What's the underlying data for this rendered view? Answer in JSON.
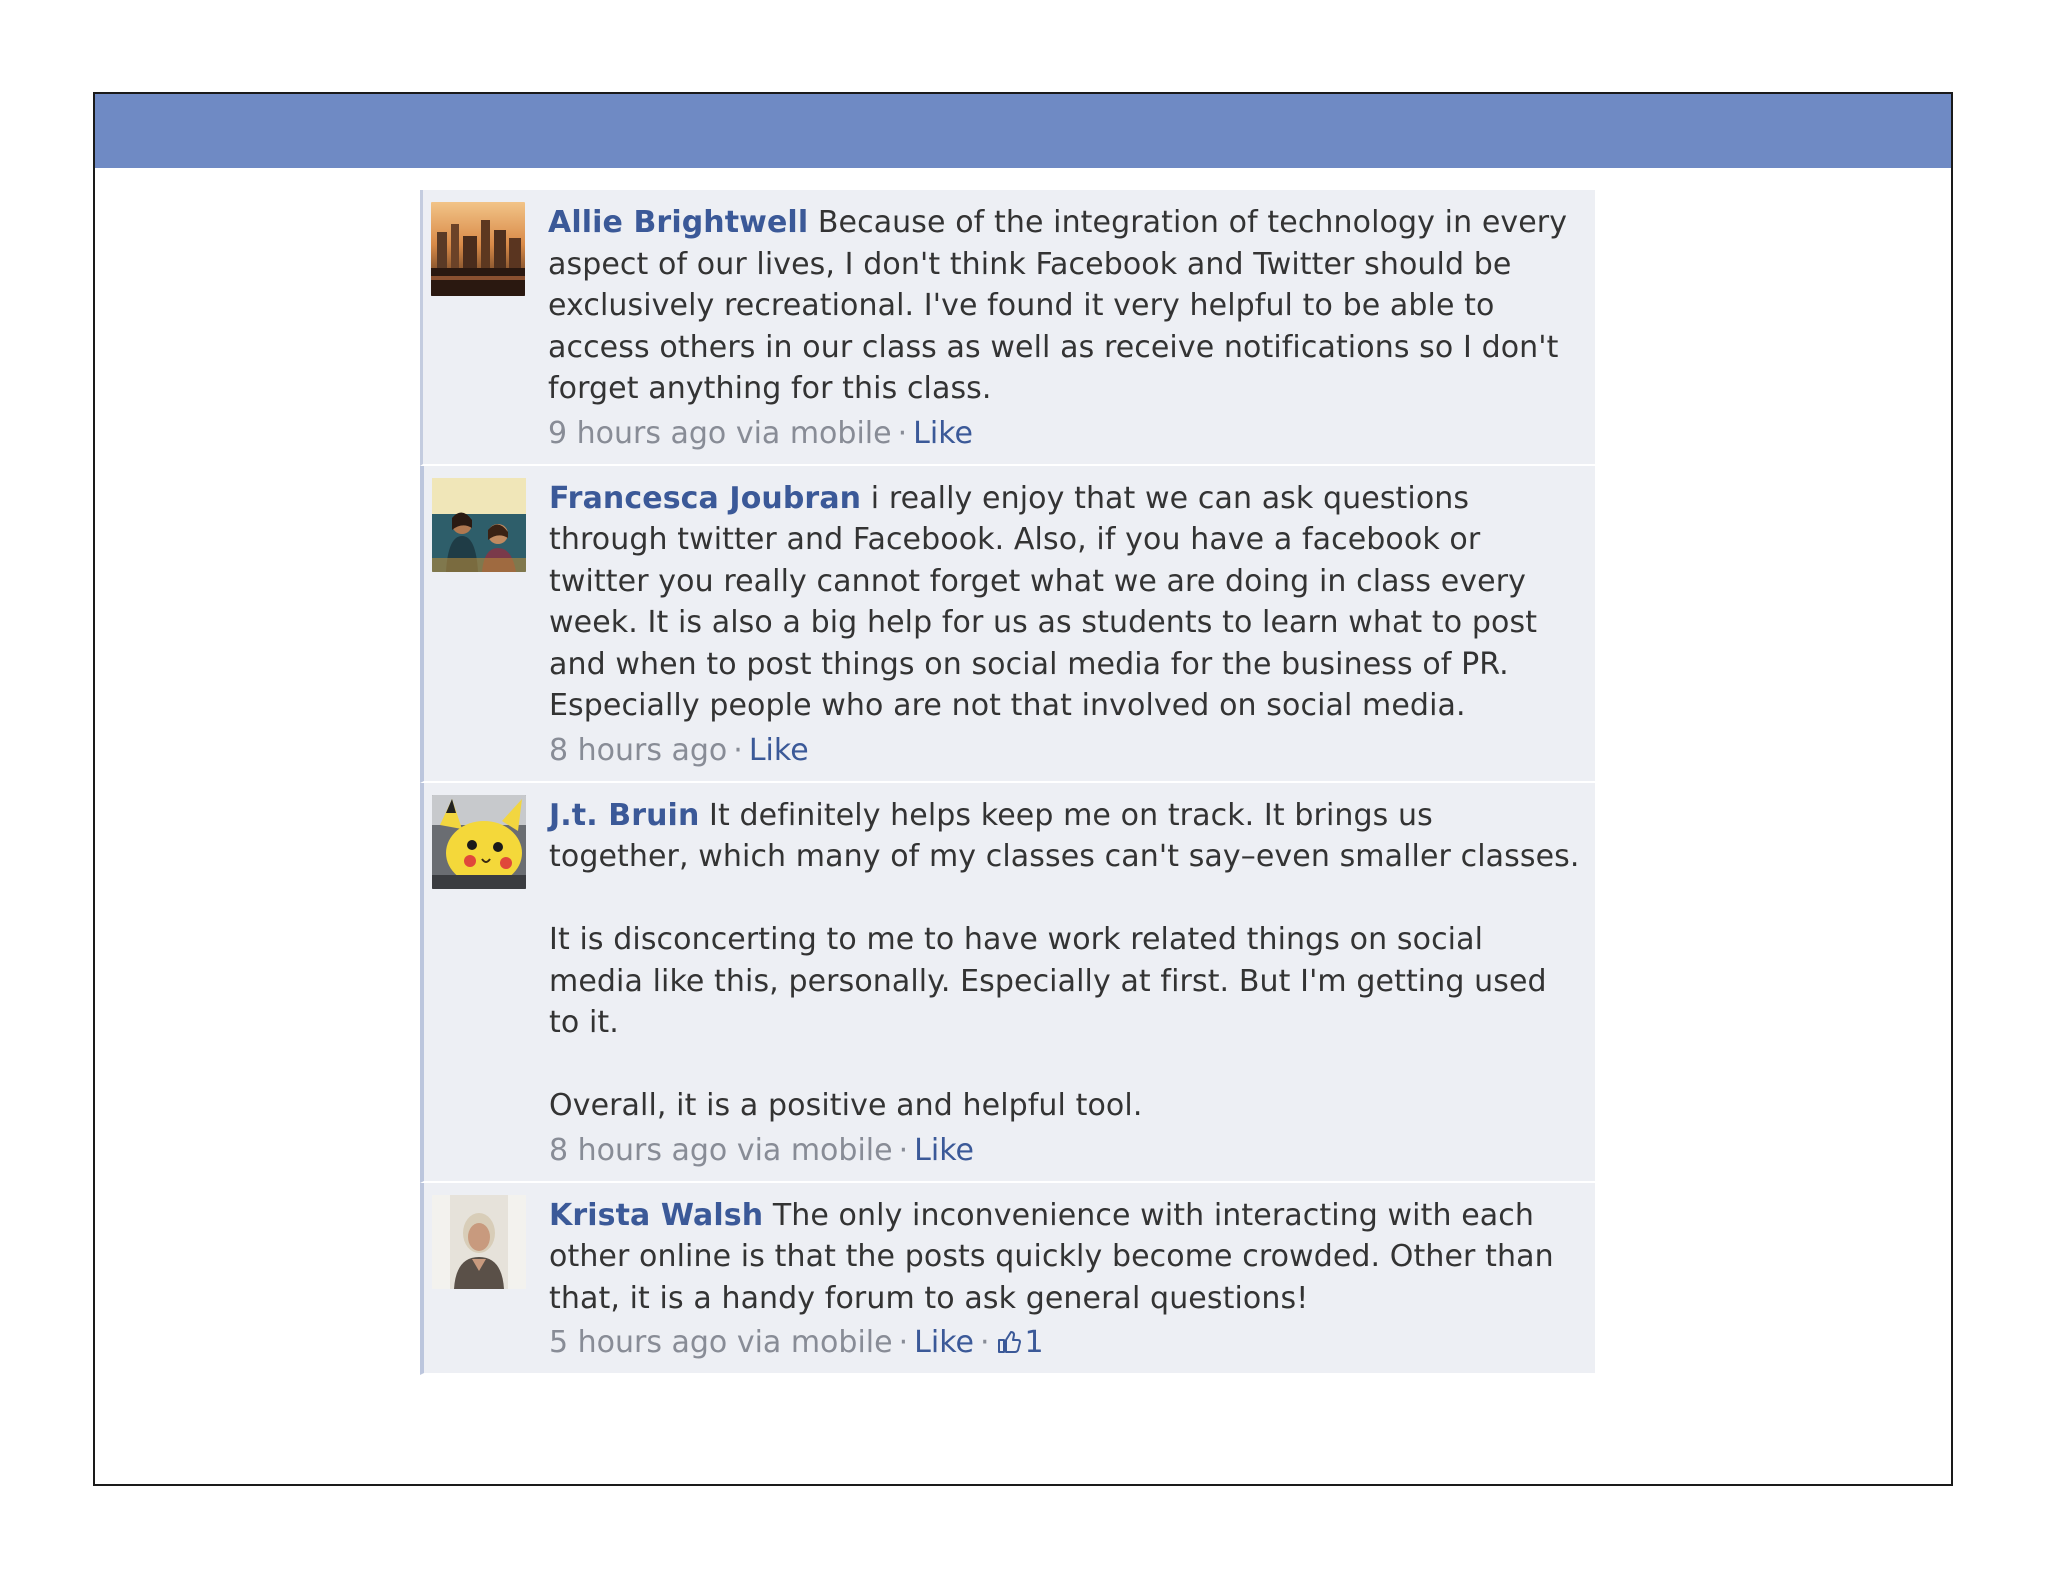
{
  "comments": [
    {
      "author": "Allie Brightwell",
      "paragraphs": [
        "Because of the integration of technology in every aspect of our lives, I don't think Facebook and Twitter should be exclusively recreational. I've found it very helpful to be able to access others in our class as well as receive notifications so I don't forget anything for this class."
      ],
      "timestamp": "9 hours ago via mobile",
      "separator": "·",
      "like_label": "Like",
      "avatar_icon": "profile-photo-cityscape"
    },
    {
      "author": "Francesca Joubran",
      "paragraphs": [
        "i really enjoy that we can ask questions through twitter and Facebook. Also, if you have a facebook or twitter you really cannot forget what we are doing in class every week. It is also a big help for us as students to learn what to post and when to post things on social media for the business of PR. Especially people who are not that involved on social media."
      ],
      "timestamp": "8 hours ago",
      "separator": "·",
      "like_label": "Like",
      "avatar_icon": "profile-photo-two-people"
    },
    {
      "author": "J.t. Bruin",
      "paragraphs": [
        "It definitely helps keep me on track. It brings us together, which many of my classes can't say–even smaller classes.",
        "It is disconcerting to me to have work related things on social media like this, personally. Especially at first. But I'm getting used to it.",
        "Overall, it is a positive and helpful tool."
      ],
      "timestamp": "8 hours ago via mobile",
      "separator": "·",
      "like_label": "Like",
      "avatar_icon": "profile-photo-pikachu"
    },
    {
      "author": "Krista Walsh",
      "paragraphs": [
        "The only inconvenience with interacting with each other online is that the posts quickly become crowded. Other than that, it is a handy forum to ask general questions!"
      ],
      "timestamp": "5 hours ago via mobile",
      "separator": "·",
      "like_label": "Like",
      "like_count": "1",
      "avatar_icon": "profile-photo-woman"
    }
  ],
  "colors": {
    "header_bar": "#6f8ac4",
    "comment_bg": "#edeff4",
    "link": "#3b5998",
    "meta_text": "#888c96"
  }
}
